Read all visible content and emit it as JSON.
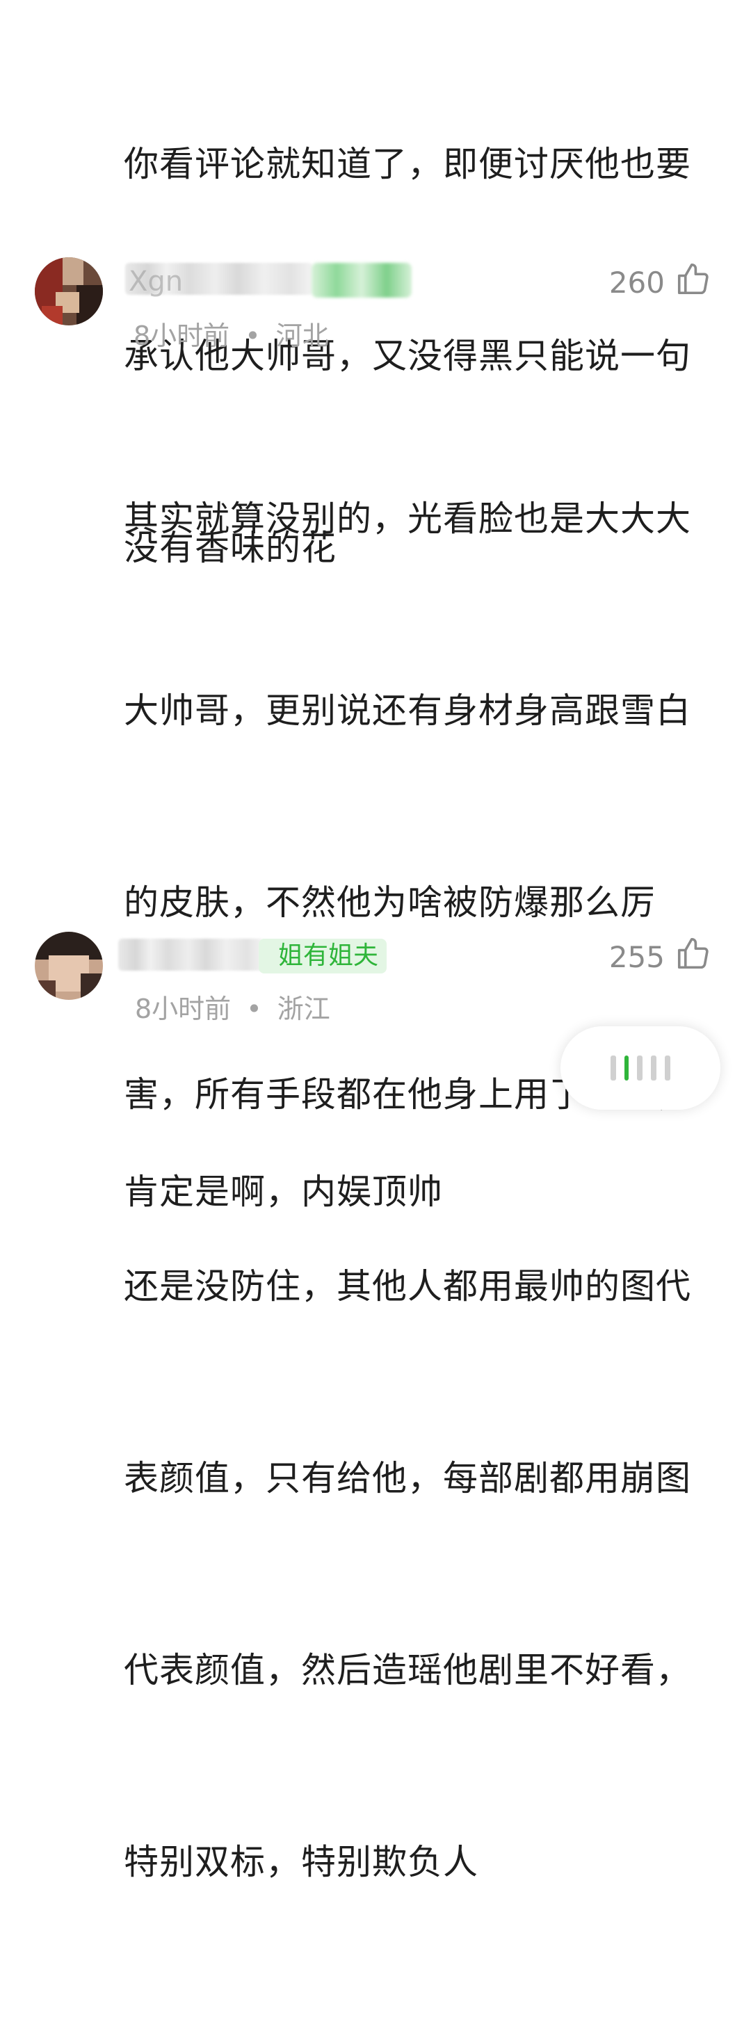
{
  "top_comment": {
    "lines": [
      "你看评论就知道了，即便讨厌他也要",
      "承认他大帅哥，又没得黑只能说一句",
      "没有香味的花"
    ]
  },
  "comments": [
    {
      "username": "Xgn",
      "badge": "",
      "time": "8小时前",
      "location": "河北",
      "likes": "260",
      "lines": [
        "其实就算没别的，光看脸也是大大大",
        "大帅哥，更别说还有身材身高跟雪白",
        "的皮肤，不然他为啥被防爆那么厉",
        "害，所有手段都在他身上用了一遍，",
        "还是没防住，其他人都用最帅的图代",
        "表颜值，只有给他，每部剧都用崩图",
        "代表颜值，然后造瑶他剧里不好看，",
        "特别双标，特别欺负人"
      ]
    },
    {
      "username": "",
      "badge": "姐有姐夫",
      "time": "8小时前",
      "location": "浙江",
      "likes": "255",
      "lines": [
        "肯定是啊，内娱顶帅"
      ]
    }
  ],
  "separator": "•",
  "colors": {
    "badge_green": "#2fb53a",
    "meta_gray": "#a3a3a3",
    "text": "#1e1e1e"
  },
  "icons": {
    "like": "thumbs-up-icon"
  }
}
